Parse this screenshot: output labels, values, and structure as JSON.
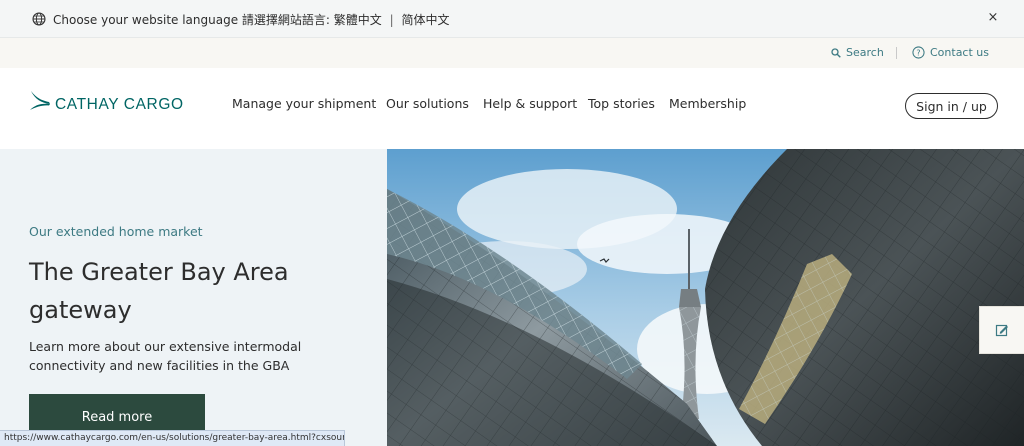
{
  "language_bar": {
    "prompt": "Choose your website language 請選擇網站語言:",
    "options": [
      "繁體中文",
      "简体中文"
    ],
    "separator": "|",
    "close_glyph": "×"
  },
  "utility_bar": {
    "search_label": "Search",
    "contact_label": "Contact us",
    "search_icon": "search-icon",
    "contact_icon": "help-circle-icon"
  },
  "header": {
    "brand": "CATHAY CARGO",
    "nav": [
      {
        "label": "Manage your shipment"
      },
      {
        "label": "Our solutions"
      },
      {
        "label": "Help & support"
      },
      {
        "label": "Top stories"
      },
      {
        "label": "Membership"
      }
    ],
    "sign_in_label": "Sign in / up"
  },
  "hero": {
    "eyebrow": "Our extended home market",
    "headline": "The Greater Bay Area gateway",
    "description": "Learn more about our extensive intermodal connectivity and new facilities in the GBA",
    "cta_label": "Read more"
  },
  "feedback": {
    "icon": "feedback-edit-icon"
  },
  "status_bar": {
    "url": "https://www.cathaycargo.com/en-us/solutions/greater-bay-area.html?cxsour..."
  },
  "colors": {
    "brand_teal": "#006564",
    "accent_teal": "#3d7a83",
    "cta_green": "#2c4a3e",
    "hero_bg": "#eef3f6",
    "utility_bg": "#f8f7f3"
  }
}
